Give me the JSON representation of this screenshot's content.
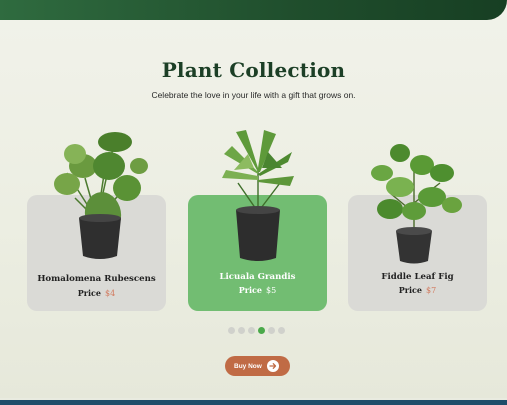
{
  "header": {
    "title": "Plant Collection",
    "subtitle": "Celebrate the love in your life with a gift that grows on."
  },
  "products": [
    {
      "name": "Homalomena Rubescens",
      "price_label": "Price",
      "price": "$4",
      "selected": false
    },
    {
      "name": "Licuala Grandis",
      "price_label": "Price",
      "price": "$5",
      "selected": true
    },
    {
      "name": "Fiddle Leaf Fig",
      "price_label": "Price",
      "price": "$7",
      "selected": false
    }
  ],
  "carousel": {
    "dot_count": 6,
    "active_index": 3
  },
  "cta": {
    "label": "Buy Now",
    "icon": "arrow-right-icon"
  },
  "colors": {
    "header_green": "#1f4d2c",
    "title": "#1c3f26",
    "card_grey": "#dadad6",
    "card_selected": "#72bd72",
    "price_accent": "#d27a5e",
    "button": "#c06b45",
    "dot_active": "#4aa94a",
    "dot_inactive": "#d0d1cc"
  }
}
